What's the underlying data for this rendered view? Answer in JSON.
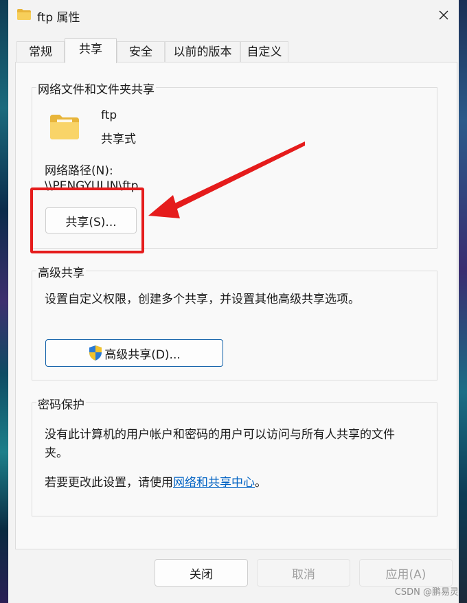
{
  "window": {
    "title": "ftp 属性"
  },
  "tabs": [
    {
      "label": "常规"
    },
    {
      "label": "共享"
    },
    {
      "label": "安全"
    },
    {
      "label": "以前的版本"
    },
    {
      "label": "自定义"
    }
  ],
  "network_sharing": {
    "group_title": "网络文件和文件夹共享",
    "folder_name": "ftp",
    "share_status": "共享式",
    "network_path_label": "网络路径(N):",
    "network_path_value": "\\\\PENGYULIN\\ftp",
    "share_button": "共享(S)..."
  },
  "advanced_sharing": {
    "group_title": "高级共享",
    "description": "设置自定义权限，创建多个共享，并设置其他高级共享选项。",
    "button": "高级共享(D)..."
  },
  "password_protection": {
    "group_title": "密码保护",
    "description_line1": "没有此计算机的用户帐户和密码的用户可以访问与所有人共享的文件",
    "description_line2": "夹。",
    "change_prefix": "若要更改此设置，请使用",
    "change_link": "网络和共享中心",
    "change_suffix": "。"
  },
  "footer": {
    "close": "关闭",
    "cancel": "取消",
    "apply": "应用(A)"
  },
  "watermark": "CSDN @鹏易灵",
  "colors": {
    "annotation_red": "#e51c1c",
    "link_blue": "#0062c3",
    "folder_yellow": "#f7c94b"
  }
}
